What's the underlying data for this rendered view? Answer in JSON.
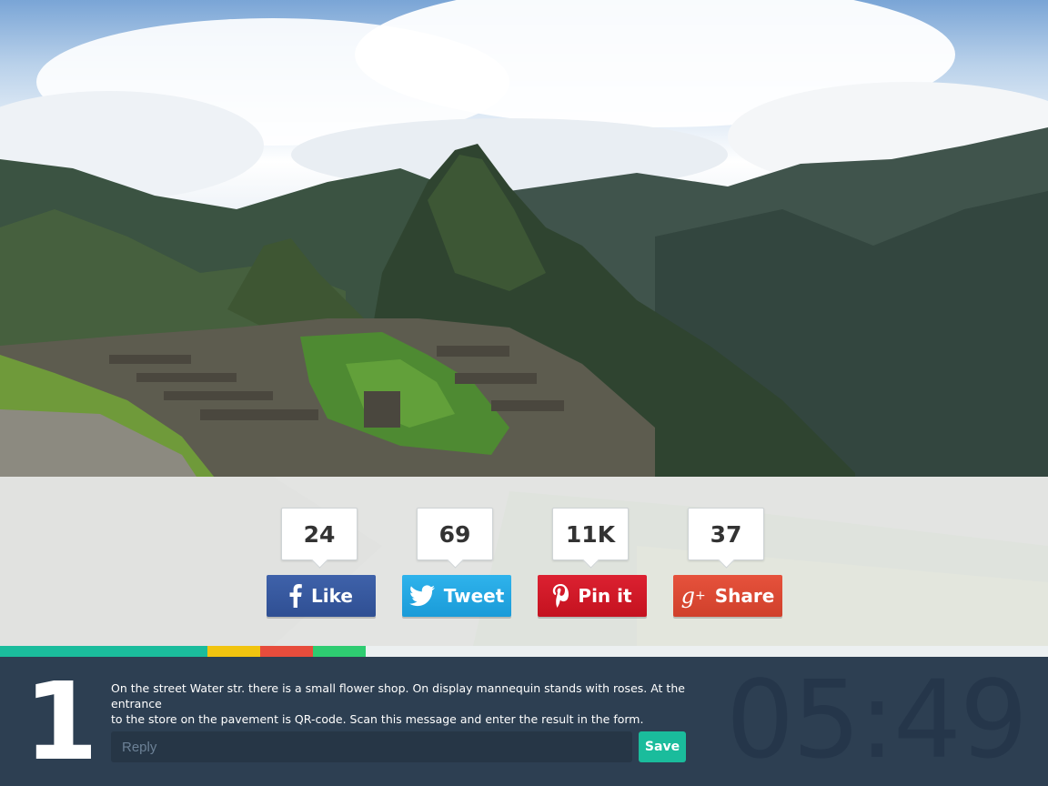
{
  "share": {
    "items": [
      {
        "count": "24",
        "label": "Like",
        "icon": "facebook-icon",
        "color": "#3b5998"
      },
      {
        "count": "69",
        "label": "Tweet",
        "icon": "twitter-icon",
        "color": "#1da1f2"
      },
      {
        "count": "11K",
        "label": "Pin it",
        "icon": "pinterest-icon",
        "color": "#cb2027"
      },
      {
        "count": "37",
        "label": "Share",
        "icon": "google-plus-icon",
        "color": "#dd4b39"
      }
    ]
  },
  "strip_colors": [
    "#1abc9c",
    "#f1c40f",
    "#e74c3c",
    "#2ecc71",
    "#ecf0f1"
  ],
  "task": {
    "number": "1",
    "message_line1": "On the street Water str. there is a small flower shop. On display mannequin stands with roses. At the entrance",
    "message_line2": "to the store on the pavement is QR-code. Scan this message and enter the result in the form.",
    "reply_placeholder": "Reply",
    "reply_value": "",
    "save_label": "Save",
    "timer": "05:49"
  }
}
